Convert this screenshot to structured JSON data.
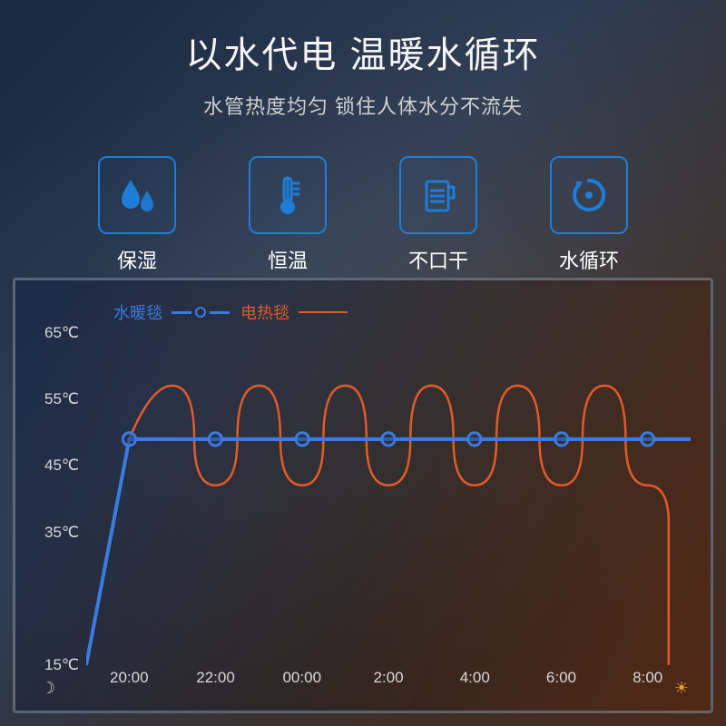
{
  "header": {
    "title": "以水代电 温暖水循环",
    "subtitle": "水管热度均匀 锁住人体水分不流失"
  },
  "features": [
    {
      "icon": "water-drops-icon",
      "label": "保湿"
    },
    {
      "icon": "thermometer-icon",
      "label": "恒温"
    },
    {
      "icon": "cup-icon",
      "label": "不口干"
    },
    {
      "icon": "cycle-icon",
      "label": "水循环"
    }
  ],
  "legend": {
    "series1_label": "水暖毯",
    "series2_label": "电热毯"
  },
  "chart_data": {
    "type": "line",
    "xlabel": "",
    "ylabel": "",
    "y_unit": "℃",
    "ylim": [
      15,
      65
    ],
    "y_ticks": [
      15,
      35,
      45,
      55,
      65
    ],
    "x_categories": [
      "20:00",
      "22:00",
      "00:00",
      "2:00",
      "4:00",
      "6:00",
      "8:00"
    ],
    "x_icons": {
      "start": "moon",
      "end": "sun"
    },
    "series": [
      {
        "name": "水暖毯",
        "color": "#3b7ae0",
        "style": "line-with-markers",
        "x": [
          "19:00",
          "20:00",
          "22:00",
          "00:00",
          "2:00",
          "4:00",
          "6:00",
          "8:00",
          "9:00"
        ],
        "values": [
          15,
          49,
          49,
          49,
          49,
          49,
          49,
          49,
          49
        ],
        "note": "rises sharply from 15℃ to ~49℃ by 20:00 then stays constant"
      },
      {
        "name": "电热毯",
        "color": "#e05a2a",
        "style": "line",
        "x": [
          "19:00",
          "20:00",
          "21:00",
          "22:00",
          "23:00",
          "00:00",
          "1:00",
          "2:00",
          "3:00",
          "4:00",
          "5:00",
          "6:00",
          "7:00",
          "8:00",
          "8:30"
        ],
        "values": [
          15,
          49,
          57,
          42,
          57,
          42,
          57,
          42,
          57,
          42,
          57,
          42,
          57,
          42,
          15
        ],
        "note": "oscillates roughly between ~42℃ and ~57℃ after ramp, then drops back to 15℃"
      }
    ]
  }
}
